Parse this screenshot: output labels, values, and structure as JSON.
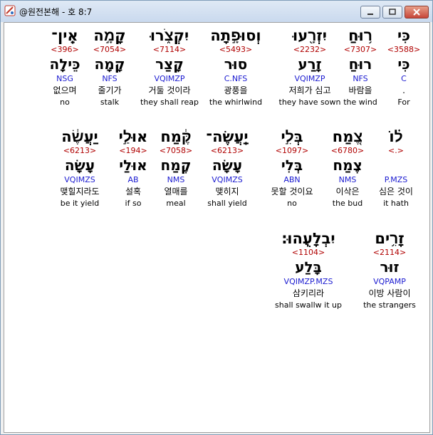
{
  "window": {
    "title": "@원전본해 - 호 8:7",
    "buttons": {
      "minimize": "minimize",
      "maximize": "maximize",
      "close": "close"
    }
  },
  "colors": {
    "strong": "#b00000",
    "parsing": "#1a1ad0",
    "text": "#000000"
  },
  "rows": [
    {
      "words": [
        {
          "hebrew": "כִּי",
          "strong": "<3588>",
          "lemma": "כִּי",
          "parsing": "C",
          "korean": ".",
          "english": "For"
        },
        {
          "hebrew": "ר֥וּחַ",
          "strong": "<7307>",
          "lemma": "רוּחַ",
          "parsing": "NFS",
          "korean": "바람을",
          "english": "the wind"
        },
        {
          "hebrew": "יִזְרָ֖עוּ",
          "strong": "<2232>",
          "lemma": "זָרַע",
          "parsing": "VQIMZP",
          "korean": "저희가 심고",
          "english": "they have sown"
        },
        {
          "hebrew": "וְסוּפָ֣תָה",
          "strong": "<5493>",
          "lemma": "סוּר",
          "parsing": "C.NFS",
          "korean": "광풍을",
          "english": "the whirlwind"
        },
        {
          "hebrew": "יִקְצֹ֑רוּ",
          "strong": "<7114>",
          "lemma": "קָצַר",
          "parsing": "VQIMZP",
          "korean": "거둘 것이라",
          "english": "they shall reap"
        },
        {
          "hebrew": "קָמָ֣ה",
          "strong": "<7054>",
          "lemma": "קָמָה",
          "parsing": "NFS",
          "korean": "줄기가",
          "english": "stalk"
        },
        {
          "hebrew": "אֵֽין־",
          "strong": "<396>",
          "lemma": "כֵּילָה",
          "parsing": "NSG",
          "korean": "없으며",
          "english": "no"
        }
      ]
    },
    {
      "words": [
        {
          "hebrew": "ל֗וֹ",
          "strong": "<.>",
          "lemma": "",
          "parsing": "P.MZS",
          "korean": "심은 것이",
          "english": "it hath"
        },
        {
          "hebrew": "צֶ֚מַח",
          "strong": "<6780>",
          "lemma": "צֶמַח",
          "parsing": "NMS",
          "korean": "이삭은",
          "english": "the bud"
        },
        {
          "hebrew": "בְּלִ֣י",
          "strong": "<1097>",
          "lemma": "בְּלִי",
          "parsing": "ABN",
          "korean": "못할 것이요",
          "english": "no"
        },
        {
          "hebrew": "יַֽעֲשֶׂה־",
          "strong": "<6213>",
          "lemma": "עָשָׂה",
          "parsing": "VQIMZS",
          "korean": "맺히지",
          "english": "shall yield"
        },
        {
          "hebrew": "קֶּ֔מַח",
          "strong": "<7058>",
          "lemma": "קֶמַח",
          "parsing": "NMS",
          "korean": "열매를",
          "english": "meal"
        },
        {
          "hebrew": "אוּלַ֣י",
          "strong": "<194>",
          "lemma": "אוּלַי",
          "parsing": "AB",
          "korean": "설혹",
          "english": "if so"
        },
        {
          "hebrew": "יַעֲשֶׂ֔ה",
          "strong": "<6213>",
          "lemma": "עָשָׂה",
          "parsing": "VQIMZS",
          "korean": "맺힐지라도",
          "english": "be it yield"
        }
      ]
    },
    {
      "words": [
        {
          "hebrew": "זָרִ֥ים",
          "strong": "<2114>",
          "lemma": "זוּר",
          "parsing": "VQPAMP",
          "korean": "이방 사람이",
          "english": "the strangers"
        },
        {
          "hebrew": "יִבְלָעֻֽהוּ׃",
          "strong": "<1104>",
          "lemma": "בָּלַע",
          "parsing": "VQIMZP.MZS",
          "korean": "삼키리라",
          "english": "shall swallw it up"
        }
      ]
    }
  ]
}
